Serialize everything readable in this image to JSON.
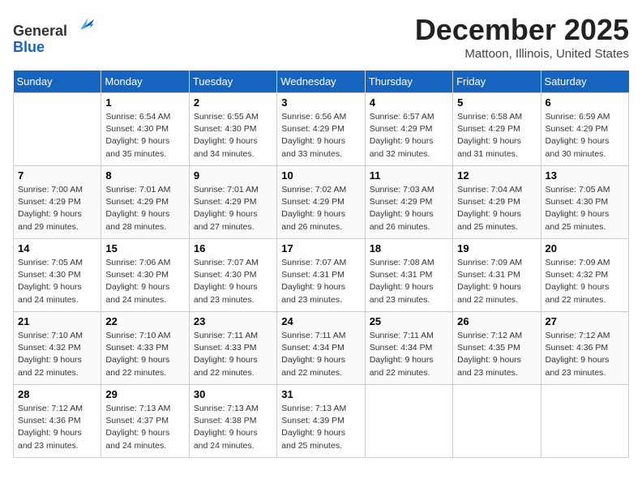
{
  "header": {
    "logo_line1": "General",
    "logo_line2": "Blue",
    "month_title": "December 2025",
    "location": "Mattoon, Illinois, United States"
  },
  "days_of_week": [
    "Sunday",
    "Monday",
    "Tuesday",
    "Wednesday",
    "Thursday",
    "Friday",
    "Saturday"
  ],
  "weeks": [
    [
      {
        "day": "",
        "info": ""
      },
      {
        "day": "1",
        "info": "Sunrise: 6:54 AM\nSunset: 4:30 PM\nDaylight: 9 hours\nand 35 minutes."
      },
      {
        "day": "2",
        "info": "Sunrise: 6:55 AM\nSunset: 4:30 PM\nDaylight: 9 hours\nand 34 minutes."
      },
      {
        "day": "3",
        "info": "Sunrise: 6:56 AM\nSunset: 4:29 PM\nDaylight: 9 hours\nand 33 minutes."
      },
      {
        "day": "4",
        "info": "Sunrise: 6:57 AM\nSunset: 4:29 PM\nDaylight: 9 hours\nand 32 minutes."
      },
      {
        "day": "5",
        "info": "Sunrise: 6:58 AM\nSunset: 4:29 PM\nDaylight: 9 hours\nand 31 minutes."
      },
      {
        "day": "6",
        "info": "Sunrise: 6:59 AM\nSunset: 4:29 PM\nDaylight: 9 hours\nand 30 minutes."
      }
    ],
    [
      {
        "day": "7",
        "info": "Sunrise: 7:00 AM\nSunset: 4:29 PM\nDaylight: 9 hours\nand 29 minutes."
      },
      {
        "day": "8",
        "info": "Sunrise: 7:01 AM\nSunset: 4:29 PM\nDaylight: 9 hours\nand 28 minutes."
      },
      {
        "day": "9",
        "info": "Sunrise: 7:01 AM\nSunset: 4:29 PM\nDaylight: 9 hours\nand 27 minutes."
      },
      {
        "day": "10",
        "info": "Sunrise: 7:02 AM\nSunset: 4:29 PM\nDaylight: 9 hours\nand 26 minutes."
      },
      {
        "day": "11",
        "info": "Sunrise: 7:03 AM\nSunset: 4:29 PM\nDaylight: 9 hours\nand 26 minutes."
      },
      {
        "day": "12",
        "info": "Sunrise: 7:04 AM\nSunset: 4:29 PM\nDaylight: 9 hours\nand 25 minutes."
      },
      {
        "day": "13",
        "info": "Sunrise: 7:05 AM\nSunset: 4:30 PM\nDaylight: 9 hours\nand 25 minutes."
      }
    ],
    [
      {
        "day": "14",
        "info": "Sunrise: 7:05 AM\nSunset: 4:30 PM\nDaylight: 9 hours\nand 24 minutes."
      },
      {
        "day": "15",
        "info": "Sunrise: 7:06 AM\nSunset: 4:30 PM\nDaylight: 9 hours\nand 24 minutes."
      },
      {
        "day": "16",
        "info": "Sunrise: 7:07 AM\nSunset: 4:30 PM\nDaylight: 9 hours\nand 23 minutes."
      },
      {
        "day": "17",
        "info": "Sunrise: 7:07 AM\nSunset: 4:31 PM\nDaylight: 9 hours\nand 23 minutes."
      },
      {
        "day": "18",
        "info": "Sunrise: 7:08 AM\nSunset: 4:31 PM\nDaylight: 9 hours\nand 23 minutes."
      },
      {
        "day": "19",
        "info": "Sunrise: 7:09 AM\nSunset: 4:31 PM\nDaylight: 9 hours\nand 22 minutes."
      },
      {
        "day": "20",
        "info": "Sunrise: 7:09 AM\nSunset: 4:32 PM\nDaylight: 9 hours\nand 22 minutes."
      }
    ],
    [
      {
        "day": "21",
        "info": "Sunrise: 7:10 AM\nSunset: 4:32 PM\nDaylight: 9 hours\nand 22 minutes."
      },
      {
        "day": "22",
        "info": "Sunrise: 7:10 AM\nSunset: 4:33 PM\nDaylight: 9 hours\nand 22 minutes."
      },
      {
        "day": "23",
        "info": "Sunrise: 7:11 AM\nSunset: 4:33 PM\nDaylight: 9 hours\nand 22 minutes."
      },
      {
        "day": "24",
        "info": "Sunrise: 7:11 AM\nSunset: 4:34 PM\nDaylight: 9 hours\nand 22 minutes."
      },
      {
        "day": "25",
        "info": "Sunrise: 7:11 AM\nSunset: 4:34 PM\nDaylight: 9 hours\nand 22 minutes."
      },
      {
        "day": "26",
        "info": "Sunrise: 7:12 AM\nSunset: 4:35 PM\nDaylight: 9 hours\nand 23 minutes."
      },
      {
        "day": "27",
        "info": "Sunrise: 7:12 AM\nSunset: 4:36 PM\nDaylight: 9 hours\nand 23 minutes."
      }
    ],
    [
      {
        "day": "28",
        "info": "Sunrise: 7:12 AM\nSunset: 4:36 PM\nDaylight: 9 hours\nand 23 minutes."
      },
      {
        "day": "29",
        "info": "Sunrise: 7:13 AM\nSunset: 4:37 PM\nDaylight: 9 hours\nand 24 minutes."
      },
      {
        "day": "30",
        "info": "Sunrise: 7:13 AM\nSunset: 4:38 PM\nDaylight: 9 hours\nand 24 minutes."
      },
      {
        "day": "31",
        "info": "Sunrise: 7:13 AM\nSunset: 4:39 PM\nDaylight: 9 hours\nand 25 minutes."
      },
      {
        "day": "",
        "info": ""
      },
      {
        "day": "",
        "info": ""
      },
      {
        "day": "",
        "info": ""
      }
    ]
  ]
}
